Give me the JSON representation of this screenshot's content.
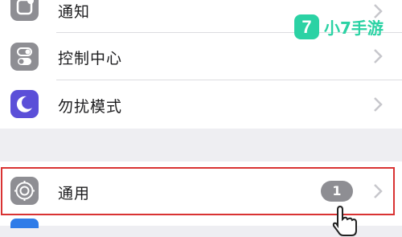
{
  "settings": {
    "rows": [
      {
        "label": "通知",
        "icon": "notification-icon",
        "color": "#8e8e93"
      },
      {
        "label": "控制中心",
        "icon": "toggle-switch-icon",
        "color": "#8e8e93"
      },
      {
        "label": "勿扰模式",
        "icon": "moon-icon",
        "color": "#5b4fd8"
      },
      {
        "label": "通用",
        "icon": "gear-icon",
        "color": "#8e8e93",
        "badge": "1"
      }
    ],
    "next_row_icon_color": "#2f7ce8"
  },
  "watermark": {
    "mark": "7",
    "text": "小7手游"
  },
  "colors": {
    "highlight": "#d93333",
    "background": "#eeeef2",
    "brand": "#2bd2a4"
  }
}
